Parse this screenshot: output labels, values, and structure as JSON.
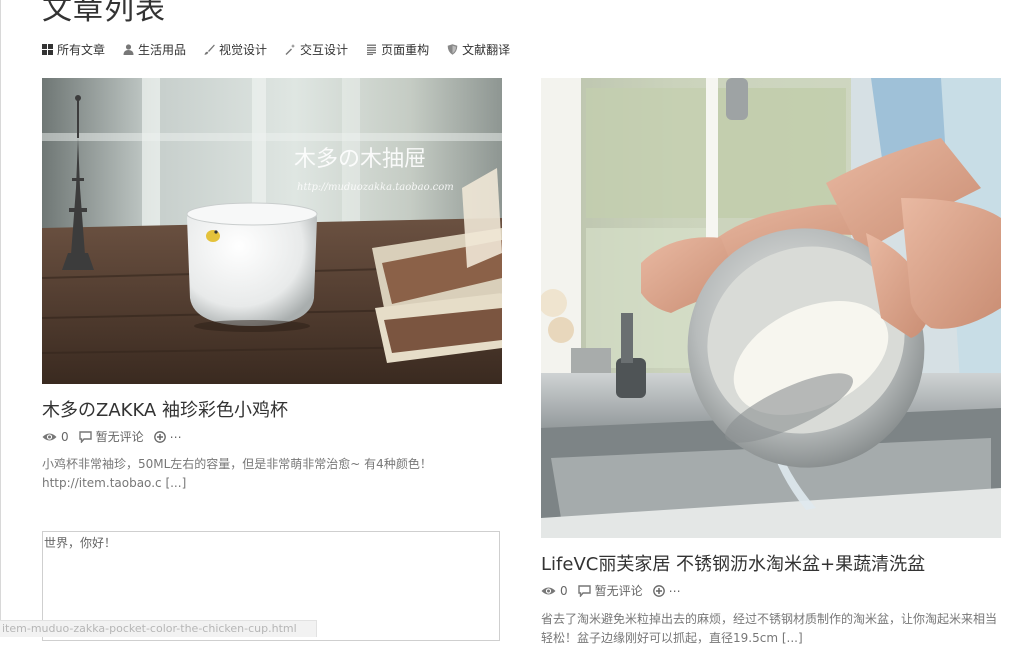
{
  "page": {
    "title": "文章列表"
  },
  "filters": [
    {
      "label": "所有文章",
      "icon": "grid-icon"
    },
    {
      "label": "生活用品",
      "icon": "user-icon"
    },
    {
      "label": "视觉设计",
      "icon": "brush-icon"
    },
    {
      "label": "交互设计",
      "icon": "magic-wand-icon"
    },
    {
      "label": "页面重构",
      "icon": "document-lines-icon"
    },
    {
      "label": "文献翻译",
      "icon": "shield-icon"
    }
  ],
  "posts": [
    {
      "title": "木多のZAKKA 袖珍彩色小鸡杯",
      "views": "0",
      "comments": "暂无评论",
      "share": "⋯",
      "excerpt": "小鸡杯非常袖珍，50ML左右的容量，但是非常萌非常治愈~ 有4种颜色！ http://item.taobao.c",
      "more": "[...]",
      "watermark_title": "木多の木抽屉",
      "watermark_url": "http://muduozakka.taobao.com"
    },
    {
      "title": "LifeVC丽芙家居 不锈钢沥水淘米盆+果蔬清洗盆",
      "views": "0",
      "comments": "暂无评论",
      "share": "⋯",
      "excerpt": "省去了淘米避免米粒掉出去的麻烦，经过不锈钢材质制作的淘米盆，让你淘起米来相当轻松！盆子边缘刚好可以抓起，直径19.5cm",
      "more": "[...]"
    }
  ],
  "hello_box": {
    "text": "世界，你好！"
  },
  "status_bar": {
    "url": "item-muduo-zakka-pocket-color-the-chicken-cup.html"
  }
}
